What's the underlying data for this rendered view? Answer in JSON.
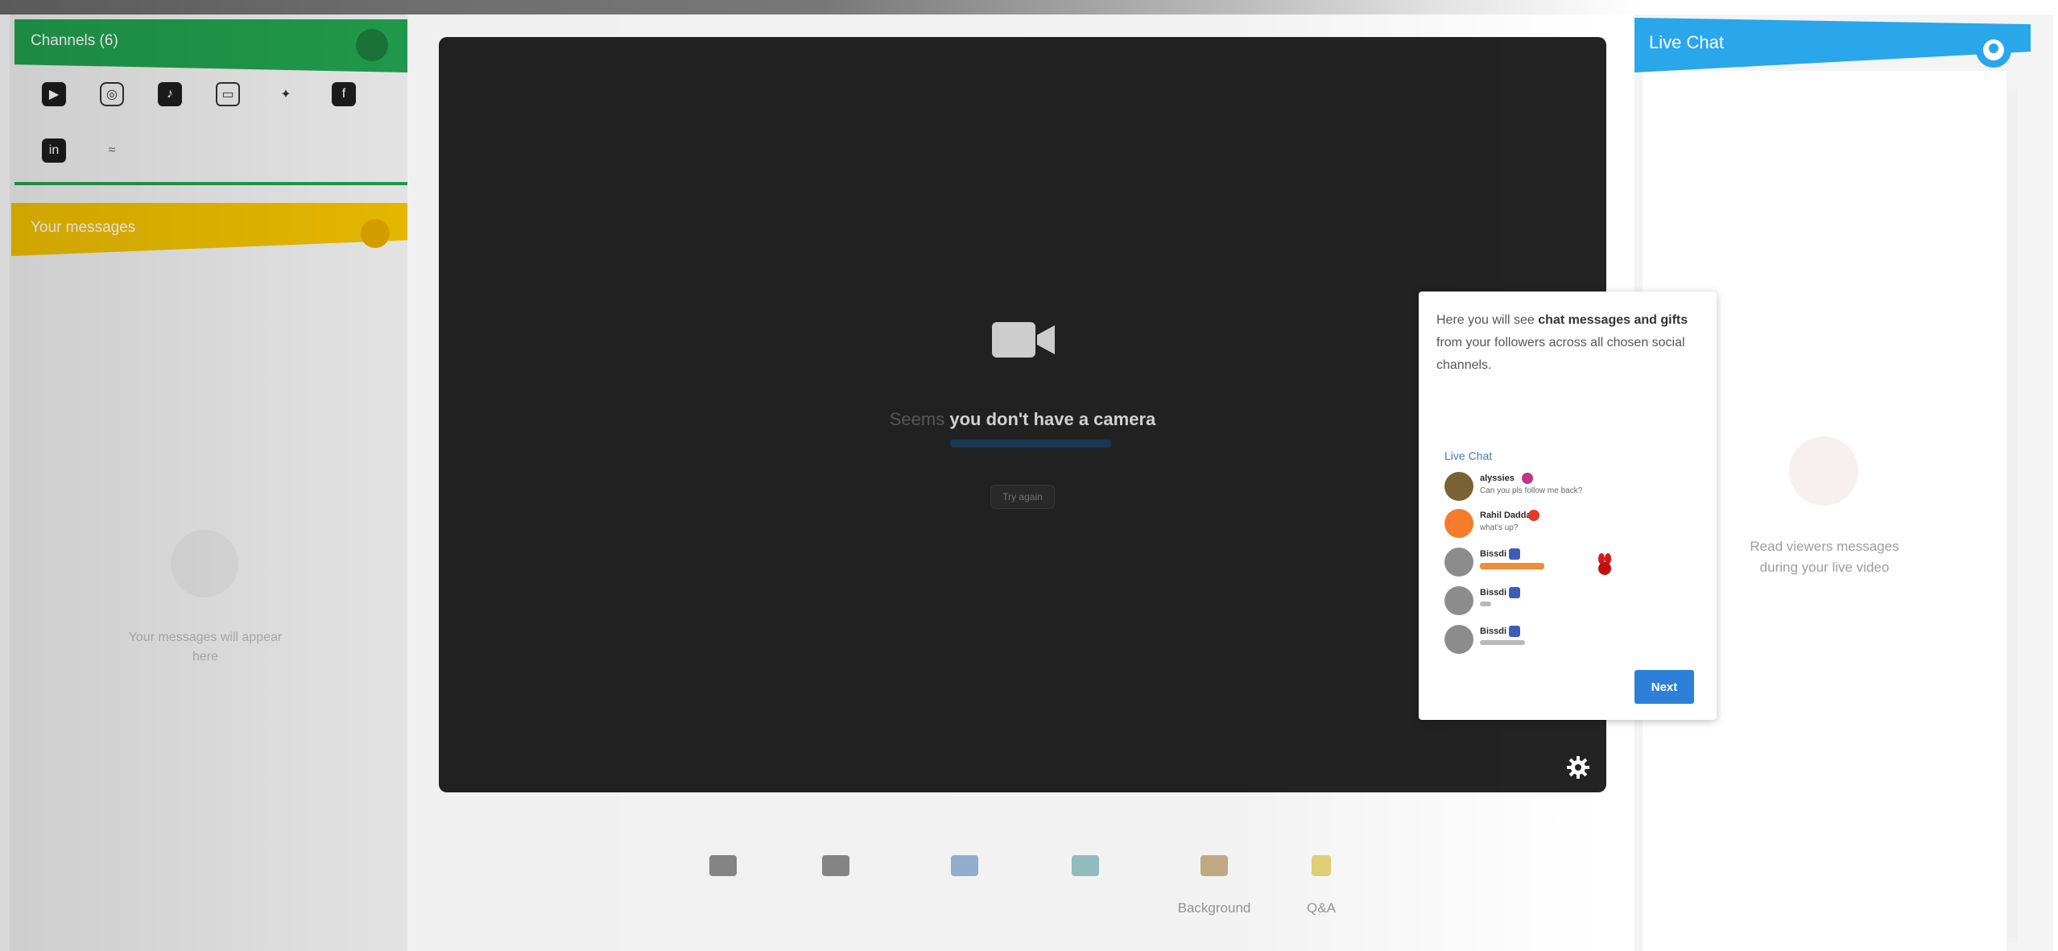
{
  "left_panel": {
    "channels_title": "Channels (6)",
    "social_icons": [
      "youtube-icon",
      "instagram-icon",
      "tiktok-icon",
      "twitch-icon",
      "twitter-icon",
      "facebook-icon",
      "linkedin-icon",
      "rss-icon"
    ],
    "messages_title": "Your messages",
    "messages_empty_text": "Your messages will appear here"
  },
  "video": {
    "camera_title_prefix": "Seems",
    "camera_title_main": "you don't have a camera",
    "try_again_label": "Try again"
  },
  "tooltip": {
    "text_intro": "Here you will see ",
    "text_bold": "chat messages and gifts",
    "text_rest": " from your followers across all chosen social channels.",
    "preview_title": "Live Chat",
    "preview_messages": [
      {
        "name": "alyssies",
        "text": "Can you pls follow me back?",
        "badge_color": "#c13584"
      },
      {
        "name": "Rahil Dadda",
        "text": "what's up?",
        "badge_color": "#e03a2b"
      },
      {
        "name": "Bissdi",
        "text": "",
        "badge_color": "#3c5db6"
      },
      {
        "name": "Bissdi",
        "text": "",
        "badge_color": "#3c5db6"
      },
      {
        "name": "Bissdi",
        "text": "",
        "badge_color": "#3c5db6"
      }
    ],
    "next_label": "Next"
  },
  "chat": {
    "title": "Live Chat",
    "empty_text": "Read viewers messages during your live video"
  },
  "toolbar": {
    "items": [
      {
        "label": "",
        "icon": "share-icon",
        "color": "#8c8c8c"
      },
      {
        "label": "",
        "icon": "comment-icon",
        "color": "#8c8c8c"
      },
      {
        "label": "",
        "icon": "media-icon",
        "color": "#9ab6d6"
      },
      {
        "label": "",
        "icon": "poll-icon",
        "color": "#9ac6c6"
      },
      {
        "label": "Background",
        "icon": "background-icon",
        "color": "#c9b28a"
      },
      {
        "label": "Q&A",
        "icon": "qa-icon",
        "color": "#e9d67c"
      }
    ]
  },
  "colors": {
    "channels_green": "#22a14f",
    "messages_yellow": "#f2c200",
    "chat_blue": "#2aa6ea",
    "next_blue": "#2d7fd8"
  }
}
